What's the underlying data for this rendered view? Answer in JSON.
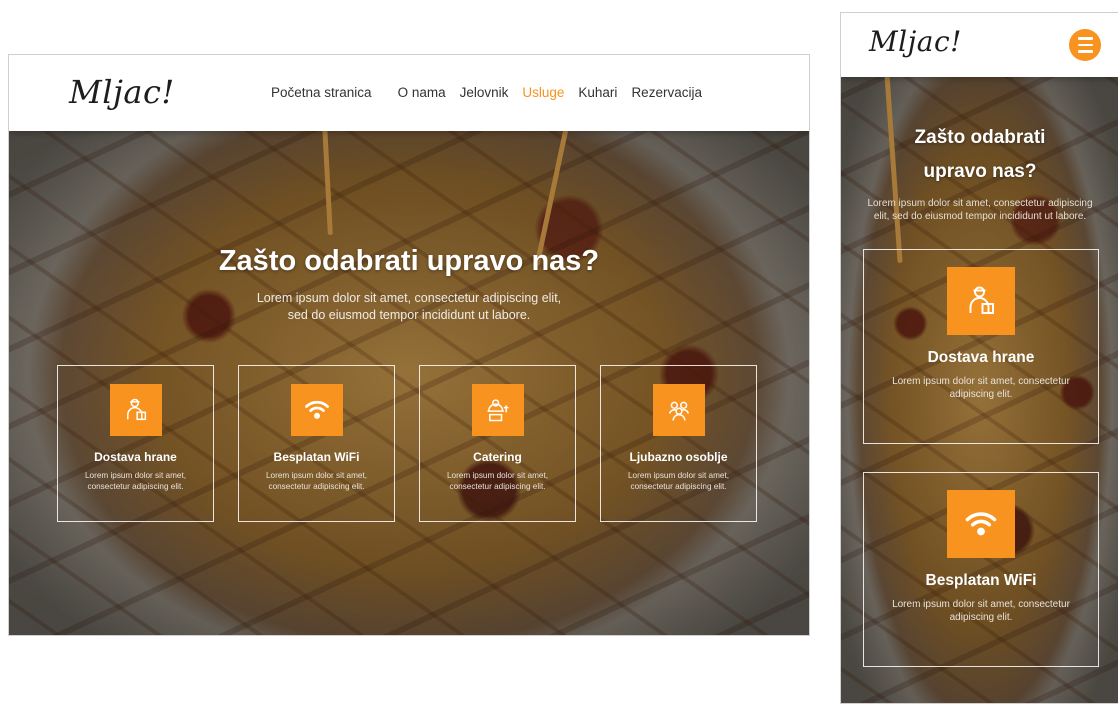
{
  "brand": {
    "logo_text": "Mljac!",
    "accent_color": "#f7931e"
  },
  "nav": {
    "items": [
      {
        "label": "Početna stranica"
      },
      {
        "label": "O nama"
      },
      {
        "label": "Jelovnik"
      },
      {
        "label": "Usluge",
        "active": true
      },
      {
        "label": "Kuhari"
      },
      {
        "label": "Rezervacija"
      }
    ]
  },
  "hero": {
    "headline": "Zašto odabrati upravo nas?",
    "subtext_line1": "Lorem ipsum dolor sit amet, consectetur adipiscing elit,",
    "subtext_line2": "sed do eiusmod tempor incididunt ut labore.",
    "mobile_subtext": "Lorem ipsum dolor sit amet, consectetur adipiscing elit, sed do eiusmod tempor incididunt ut labore."
  },
  "services": [
    {
      "title": "Dostava hrane",
      "text": "Lorem ipsum dolor sit amet, consectetur adipiscing elit.",
      "icon": "delivery-person-icon"
    },
    {
      "title": "Besplatan WiFi",
      "text": "Lorem ipsum dolor sit amet, consectetur adipiscing elit.",
      "icon": "wifi-icon"
    },
    {
      "title": "Catering",
      "text": "Lorem ipsum dolor sit amet, consectetur adipiscing elit.",
      "icon": "catering-icon"
    },
    {
      "title": "Ljubazno osoblje",
      "text": "Lorem ipsum dolor sit amet, consectetur adipiscing elit.",
      "icon": "staff-group-icon"
    }
  ],
  "mobile_menu_icon": "hamburger-icon"
}
